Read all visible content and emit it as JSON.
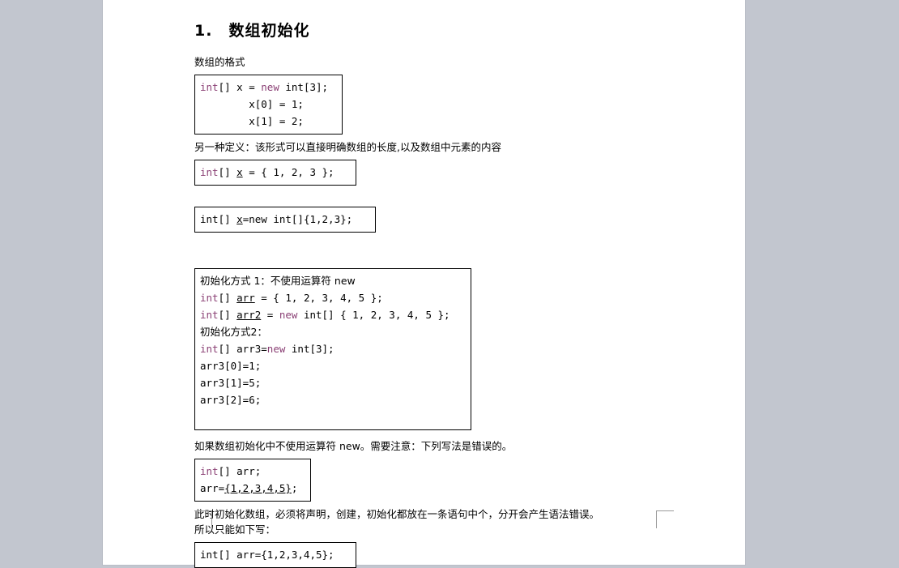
{
  "document": {
    "heading": "1.　数组初始化",
    "section_label": "数组的格式",
    "box_format": {
      "lines": [
        {
          "segments": [
            {
              "t": "int",
              "kw": true
            },
            {
              "t": "[] x = ",
              "kw": false
            },
            {
              "t": "new",
              "kw": true
            },
            {
              "t": " int[3];",
              "kw": false
            }
          ]
        },
        {
          "segments": [
            {
              "t": "        x[0] = 1;",
              "kw": false
            }
          ]
        },
        {
          "segments": [
            {
              "t": "        x[1] = 2;",
              "kw": false
            }
          ]
        }
      ]
    },
    "note_alt_definition": "另一种定义：该形式可以直接明确数组的长度,以及数组中元素的内容",
    "box_brace": {
      "lines": [
        {
          "segments": [
            {
              "t": "int",
              "kw": true
            },
            {
              "t": "[] ",
              "kw": false
            },
            {
              "t": "x",
              "kw": false,
              "u": true
            },
            {
              "t": " = { 1, 2, 3 };",
              "kw": false
            }
          ]
        }
      ]
    },
    "box_new_init": {
      "lines": [
        {
          "segments": [
            {
              "t": "int[] ",
              "kw": false
            },
            {
              "t": "x",
              "kw": false,
              "u": true
            },
            {
              "t": "=new int[]{1,2,3};",
              "kw": false
            }
          ]
        }
      ]
    },
    "box_big": {
      "lines": [
        {
          "cjk": true,
          "segments": [
            {
              "t": "初始化方式 1：不使用运算符 new",
              "kw": false
            }
          ]
        },
        {
          "segments": [
            {
              "t": "int",
              "kw": true
            },
            {
              "t": "[] ",
              "kw": false
            },
            {
              "t": "arr",
              "kw": false,
              "u": true
            },
            {
              "t": " = { 1, 2, 3, 4, 5 };",
              "kw": false
            }
          ]
        },
        {
          "segments": [
            {
              "t": "int",
              "kw": true
            },
            {
              "t": "[] ",
              "kw": false
            },
            {
              "t": "arr2",
              "kw": false,
              "u": true
            },
            {
              "t": " = ",
              "kw": false
            },
            {
              "t": "new",
              "kw": true
            },
            {
              "t": " int[] { 1, 2, 3, 4, 5 };",
              "kw": false
            }
          ]
        },
        {
          "cjk": true,
          "segments": [
            {
              "t": "初始化方式2：",
              "kw": false
            }
          ]
        },
        {
          "segments": [
            {
              "t": "int",
              "kw": true
            },
            {
              "t": "[] arr3=",
              "kw": false
            },
            {
              "t": "new",
              "kw": true
            },
            {
              "t": " int[3];",
              "kw": false
            }
          ]
        },
        {
          "segments": [
            {
              "t": "arr3[0]=1;",
              "kw": false
            }
          ]
        },
        {
          "segments": [
            {
              "t": "arr3[1]=5;",
              "kw": false
            }
          ]
        },
        {
          "segments": [
            {
              "t": "arr3[2]=6;",
              "kw": false
            }
          ]
        }
      ]
    },
    "note_error_warning": "如果数组初始化中不使用运算符 new。需要注意：下列写法是错误的。",
    "box_error": {
      "lines": [
        {
          "segments": [
            {
              "t": "int",
              "kw": true
            },
            {
              "t": "[] arr;",
              "kw": false
            }
          ]
        },
        {
          "segments": [
            {
              "t": "arr=",
              "kw": false
            },
            {
              "t": "{1,2,3,4,5}",
              "kw": false,
              "u": true
            },
            {
              "t": ";",
              "kw": false
            }
          ]
        }
      ]
    },
    "note_must_single_statement": "此时初始化数组，必须将声明，创建，初始化都放在一条语句中个，分开会产生语法错误。",
    "note_only_way": "所以只能如下写：",
    "box_final": {
      "lines": [
        {
          "segments": [
            {
              "t": "int[] arr={1,2,3,4,5};",
              "kw": false
            }
          ]
        }
      ]
    }
  },
  "colors": {
    "page_background": "#ffffff",
    "canvas_background": "#c2c6cf",
    "keyword": "#8a3f74",
    "text": "#000000",
    "box_border": "#000000",
    "crop_mark": "#9b9b9b"
  }
}
